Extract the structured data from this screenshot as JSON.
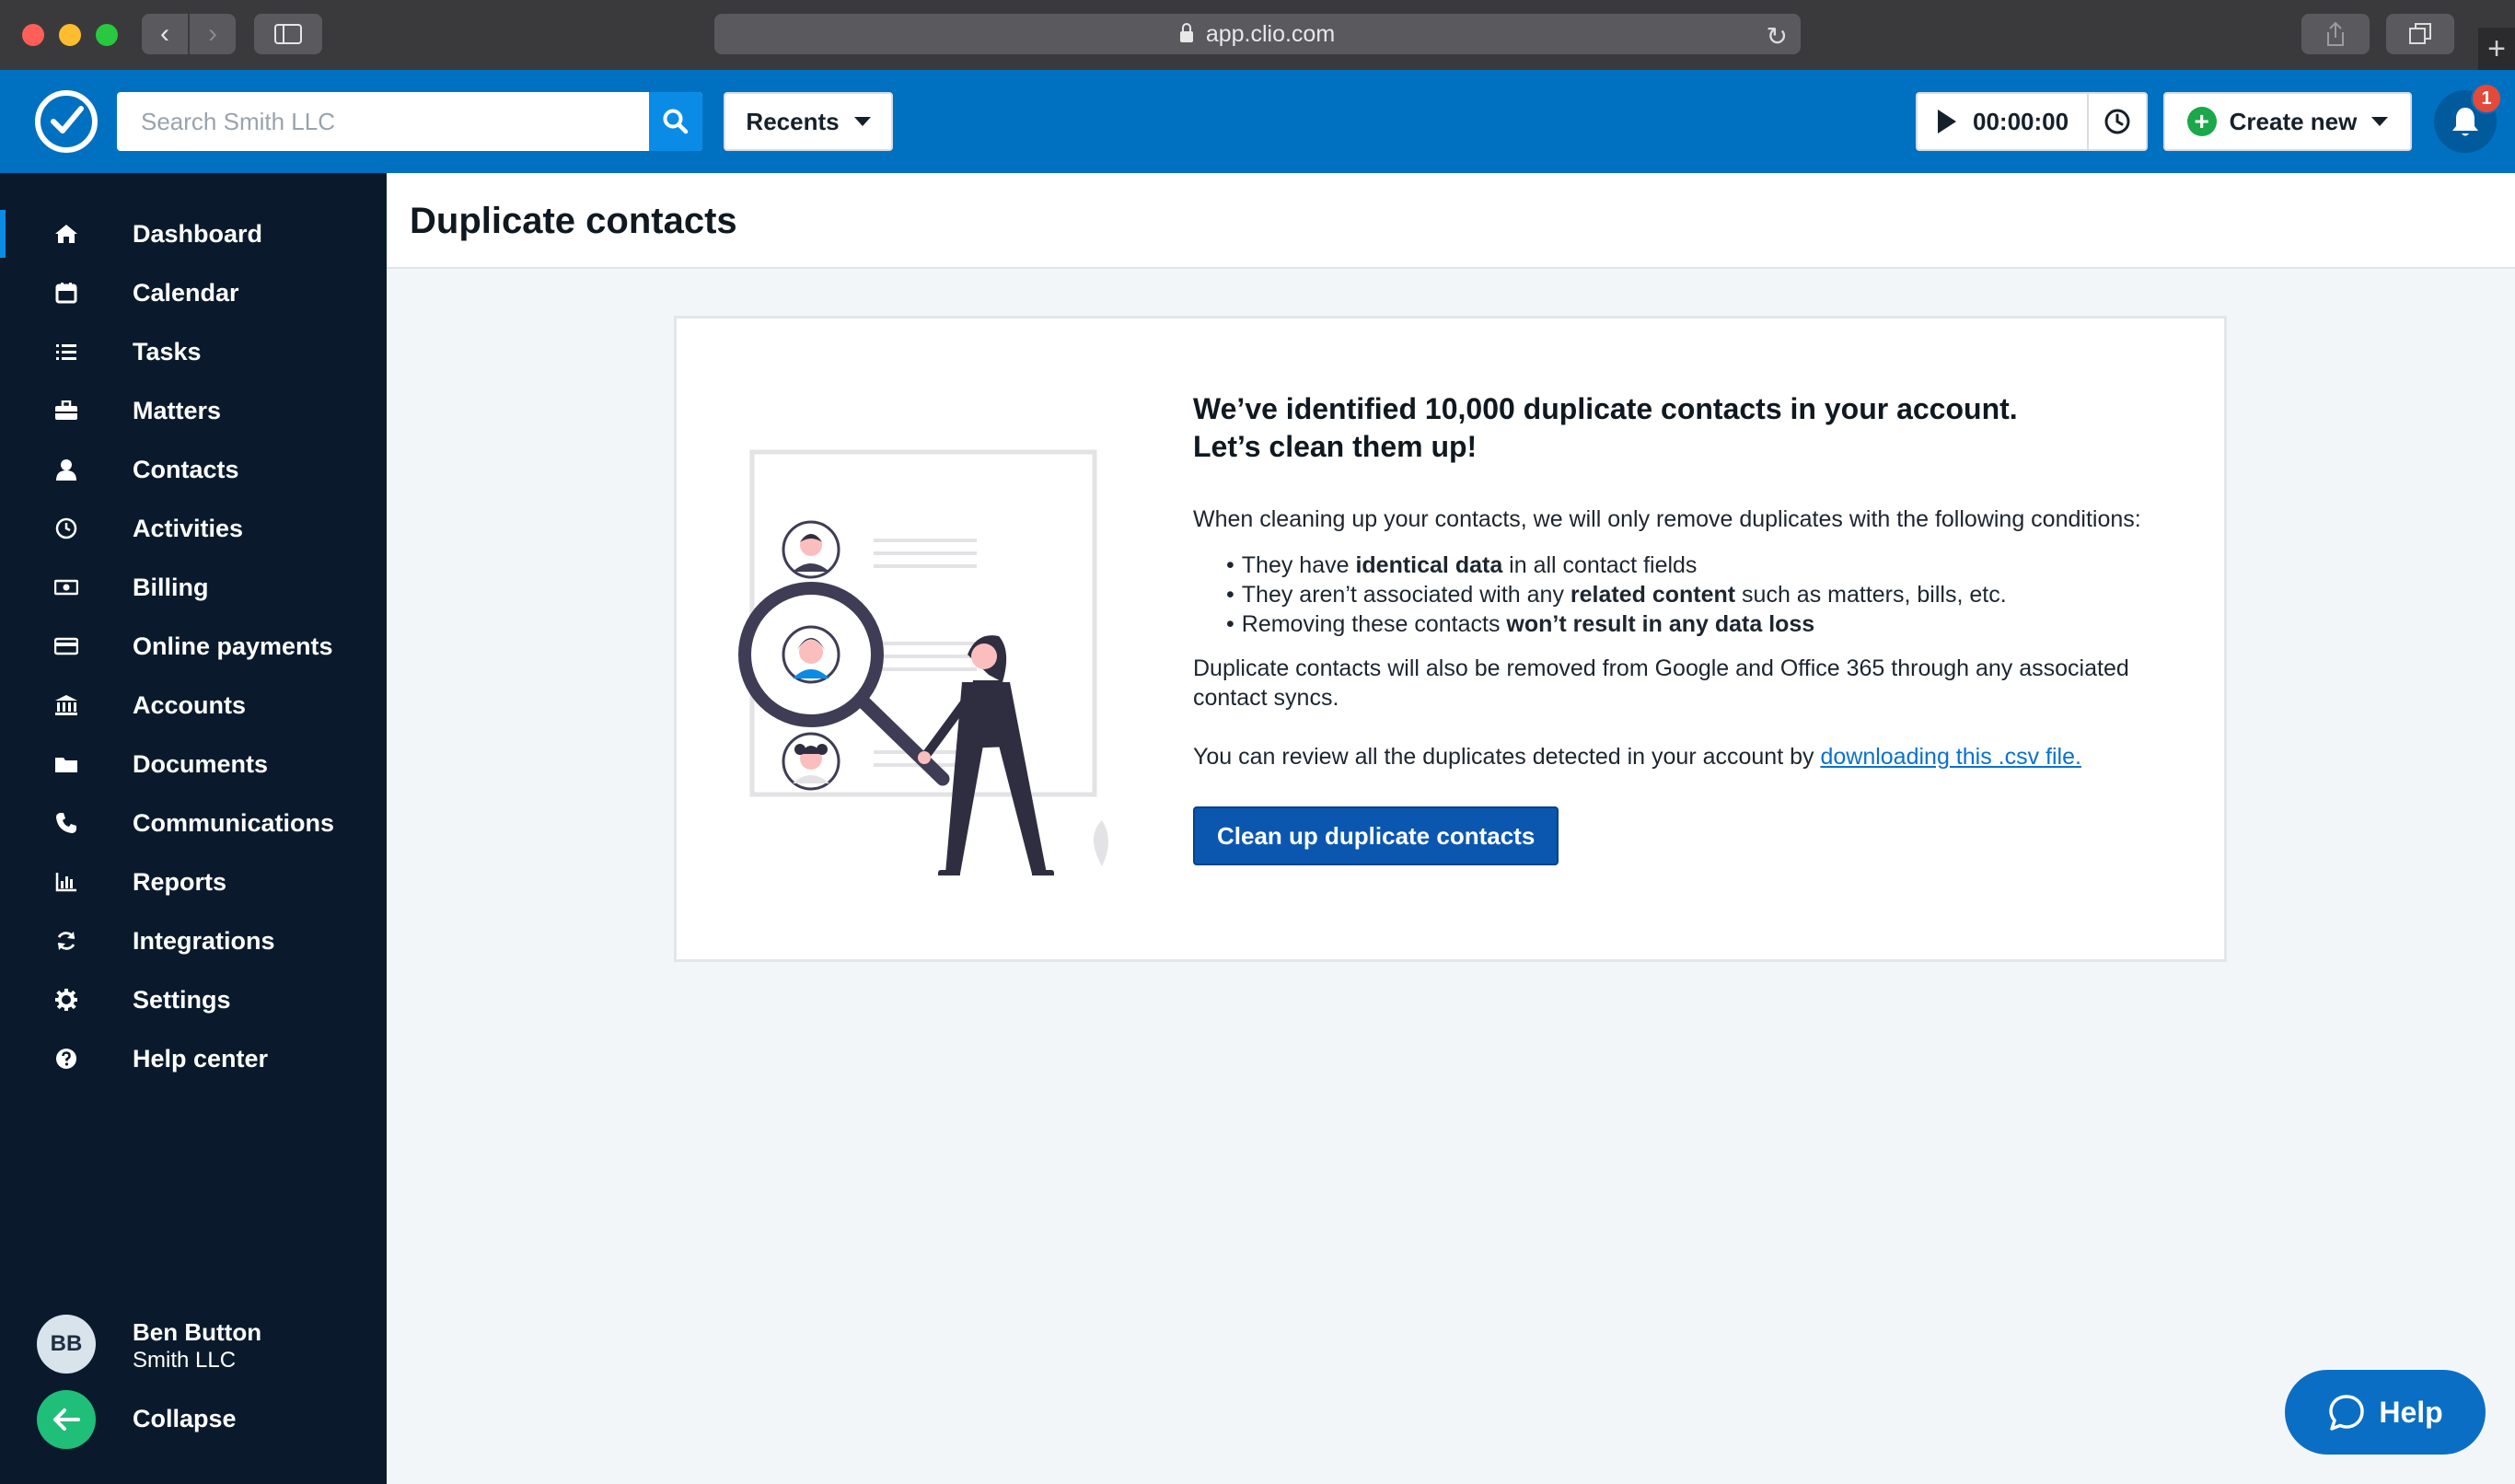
{
  "browser": {
    "url": "app.clio.com"
  },
  "header": {
    "search_placeholder": "Search Smith LLC",
    "recents_label": "Recents",
    "timer_value": "00:00:00",
    "create_label": "Create new",
    "notification_count": "1",
    "brand_color": "#0070c0"
  },
  "sidebar": {
    "items": [
      {
        "label": "Dashboard",
        "icon": "home-icon",
        "active": true
      },
      {
        "label": "Calendar",
        "icon": "calendar-icon"
      },
      {
        "label": "Tasks",
        "icon": "list-icon"
      },
      {
        "label": "Matters",
        "icon": "briefcase-icon"
      },
      {
        "label": "Contacts",
        "icon": "person-icon"
      },
      {
        "label": "Activities",
        "icon": "clock-icon"
      },
      {
        "label": "Billing",
        "icon": "money-icon"
      },
      {
        "label": "Online payments",
        "icon": "credit-card-icon"
      },
      {
        "label": "Accounts",
        "icon": "bank-icon"
      },
      {
        "label": "Documents",
        "icon": "folder-icon"
      },
      {
        "label": "Communications",
        "icon": "phone-icon"
      },
      {
        "label": "Reports",
        "icon": "bar-chart-icon"
      },
      {
        "label": "Integrations",
        "icon": "sync-icon"
      },
      {
        "label": "Settings",
        "icon": "gear-icon"
      },
      {
        "label": "Help center",
        "icon": "question-icon"
      }
    ],
    "user": {
      "initials": "BB",
      "name": "Ben Button",
      "org": "Smith LLC"
    },
    "collapse_label": "Collapse"
  },
  "page": {
    "title": "Duplicate contacts"
  },
  "card": {
    "heading_line1": "We’ve identified 10,000 duplicate contacts in your account.",
    "heading_line2": "Let’s clean them up!",
    "intro": "When cleaning up your contacts, we will only remove duplicates with the following conditions:",
    "bullets": [
      {
        "pre": "They have ",
        "bold": "identical data",
        "post": " in all contact fields"
      },
      {
        "pre": "They aren’t associated with any ",
        "bold": "related content",
        "post": " such as matters, bills, etc."
      },
      {
        "pre": "Removing these contacts ",
        "bold": "won’t result in any data loss",
        "post": ""
      }
    ],
    "sync_note": "Duplicate contacts will also be removed from Google and Office 365 through any associated contact syncs.",
    "review_text": "You can review all the duplicates detected in your account by ",
    "review_link": "downloading this .csv file.",
    "cta_label": "Clean up duplicate contacts"
  },
  "help": {
    "label": "Help"
  }
}
